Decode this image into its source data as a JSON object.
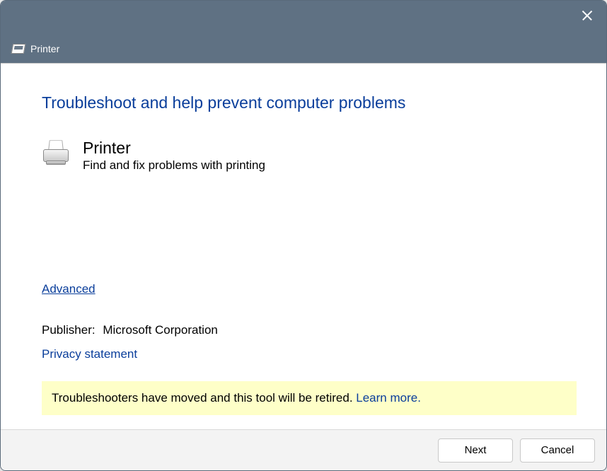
{
  "window": {
    "header_title": "Printer"
  },
  "main": {
    "heading": "Troubleshoot and help prevent computer problems",
    "category": {
      "title": "Printer",
      "description": "Find and fix problems with printing"
    },
    "advanced_link": "Advanced",
    "publisher": {
      "label": "Publisher:",
      "value": "Microsoft Corporation"
    },
    "privacy_link": "Privacy statement",
    "notice": {
      "text": "Troubleshooters have moved and this tool will be retired. ",
      "learn_more": "Learn more."
    }
  },
  "footer": {
    "next": "Next",
    "cancel": "Cancel"
  }
}
